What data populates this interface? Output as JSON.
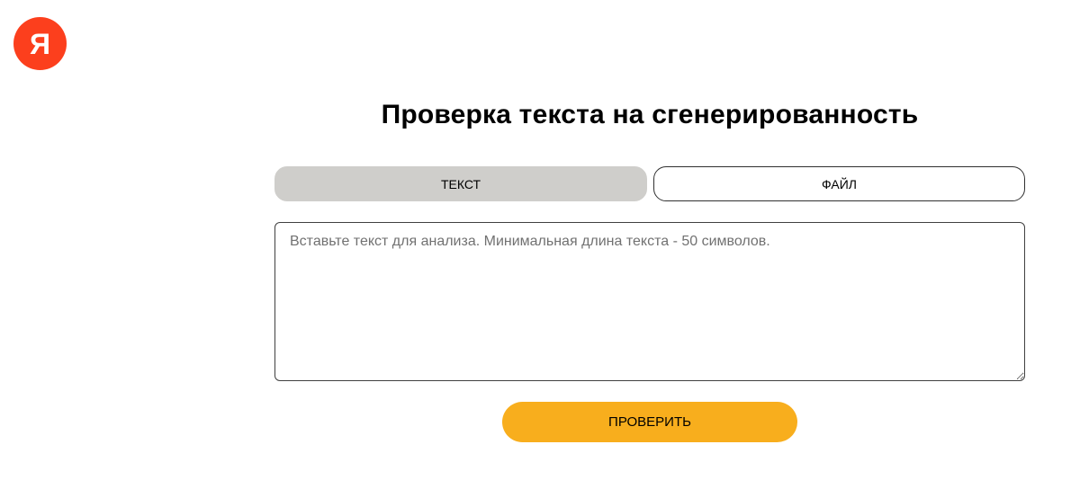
{
  "logo": {
    "icon": "yandex-logo-icon",
    "glyph": "Я",
    "color": "#fc3f1d"
  },
  "page": {
    "title": "Проверка текста на сгенерированность"
  },
  "tabs": [
    {
      "label": "ТЕКСТ",
      "active": true,
      "color": "#cfcecb"
    },
    {
      "label": "ФАЙЛ",
      "active": false,
      "color": "#ffffff"
    }
  ],
  "input": {
    "value": "",
    "placeholder": "Вставьте текст для анализа. Минимальная длина текста - 50 символов."
  },
  "submit": {
    "label": "ПРОВЕРИТЬ",
    "color": "#f8ae1d"
  }
}
